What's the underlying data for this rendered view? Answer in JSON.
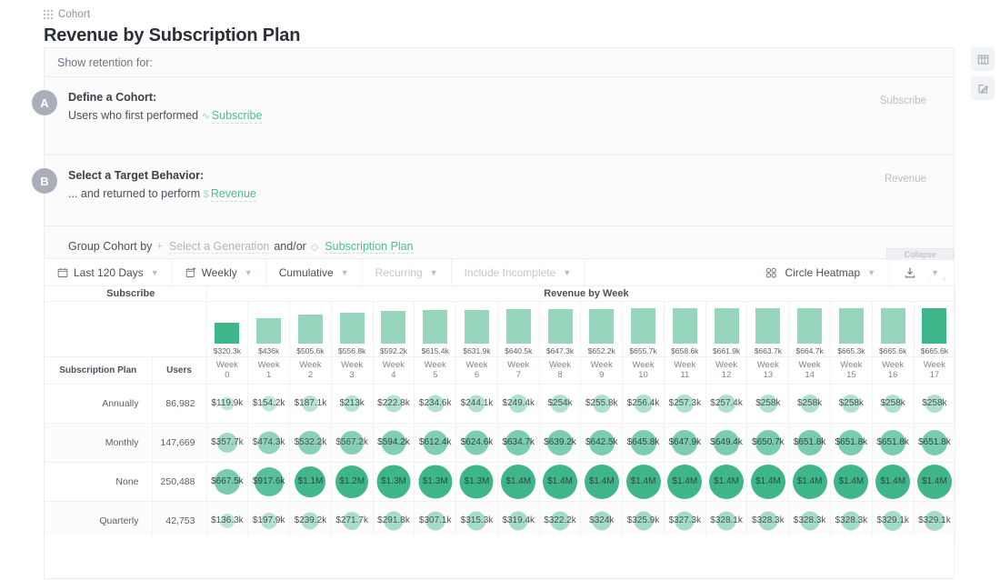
{
  "header": {
    "breadcrumb": "Cohort",
    "breadcrumb_icon": "grid-icon",
    "title": "Revenue by Subscription Plan"
  },
  "rail": {
    "items": [
      {
        "icon": "columns-icon",
        "name": "columns-panel-button"
      },
      {
        "icon": "edit-icon",
        "name": "edit-panel-button"
      }
    ]
  },
  "query": {
    "show_retention_label": "Show retention for:",
    "collapse_label": "Collapse",
    "steps": [
      {
        "badge": "A",
        "title": "Define a Cohort:",
        "prefix": "Users who first performed",
        "event_icon": "activity-icon",
        "event": "Subscribe",
        "right_label": "Subscribe"
      },
      {
        "badge": "B",
        "title": "Select a Target Behavior:",
        "prefix": "... and returned to perform",
        "event_icon": "dollar-icon",
        "event": "Revenue",
        "right_label": "Revenue"
      }
    ],
    "group_by": {
      "label": "Group Cohort by",
      "generation_icon": "plus-icon",
      "generation": "Select a Generation",
      "conjunction": "and/or",
      "property_icon": "tag-icon",
      "property": "Subscription Plan"
    }
  },
  "toolbar": {
    "date_range": "Last 120 Days",
    "date_range_icon": "calendar-icon",
    "interval": "Weekly",
    "interval_icon": "calendar-arrow-icon",
    "measure": "Cumulative",
    "recurring": "Recurring",
    "include_incomplete": "Include Incomplete",
    "viz": "Circle Heatmap",
    "viz_icon": "circle-heatmap-icon",
    "download_icon": "download-icon"
  },
  "table": {
    "corner_label": "Subscribe",
    "section_label": "Revenue by Week",
    "plan_header": "Subscription Plan",
    "users_header": "Users",
    "week_headers": [
      "Week\n0",
      "Week\n1",
      "Week\n2",
      "Week\n3",
      "Week\n4",
      "Week\n5",
      "Week\n6",
      "Week\n7",
      "Week\n8",
      "Week\n9",
      "Week\n10",
      "Week\n11",
      "Week\n12",
      "Week\n13",
      "Week\n14",
      "Week\n15",
      "Week\n16",
      "Week\n17"
    ]
  },
  "chart_data": {
    "type": "table",
    "title": "Revenue by Week",
    "xlabel": "Week",
    "ylabel": "Revenue",
    "categories": [
      "Week 0",
      "Week 1",
      "Week 2",
      "Week 3",
      "Week 4",
      "Week 5",
      "Week 6",
      "Week 7",
      "Week 8",
      "Week 9",
      "Week 10",
      "Week 11",
      "Week 12",
      "Week 13",
      "Week 14",
      "Week 15",
      "Week 16",
      "Week 17"
    ],
    "summary_bars": {
      "type": "bar",
      "labels": [
        "$320.3k",
        "$436k",
        "$505.6k",
        "$556.8k",
        "$592.2k",
        "$615.4k",
        "$631.9k",
        "$640.5k",
        "$647.3k",
        "$652.2k",
        "$655.7k",
        "$658.6k",
        "$661.9k",
        "$663.7k",
        "$664.7k",
        "$665.3k",
        "$665.6k",
        "$665.6k"
      ],
      "values": [
        320300,
        436000,
        505600,
        556800,
        592200,
        615400,
        631900,
        640500,
        647300,
        652200,
        655700,
        658600,
        661900,
        663700,
        664700,
        665300,
        665600,
        665600
      ],
      "highlighted_index": [
        0,
        17
      ],
      "bar_color": "#97d6bd",
      "highlight_color": "#3fb68a"
    },
    "rows": [
      {
        "plan": "Annually",
        "users": "86,982",
        "users_value": 86982,
        "values": [
          "$119.9k",
          "$154.2k",
          "$187.1k",
          "$213k",
          "$222.8k",
          "$234.6k",
          "$244.1k",
          "$249.4k",
          "$254k",
          "$255.8k",
          "$256.4k",
          "$257.3k",
          "$257.4k",
          "$258k",
          "$258k",
          "$258k",
          "$258k",
          "$258k"
        ],
        "numeric": [
          119900,
          154200,
          187100,
          213000,
          222800,
          234600,
          244100,
          249400,
          254000,
          255800,
          256400,
          257300,
          257400,
          258000,
          258000,
          258000,
          258000,
          258000
        ]
      },
      {
        "plan": "Monthly",
        "users": "147,669",
        "users_value": 147669,
        "values": [
          "$357.7k",
          "$474.3k",
          "$532.2k",
          "$567.2k",
          "$594.2k",
          "$612.4k",
          "$624.6k",
          "$634.7k",
          "$639.2k",
          "$642.5k",
          "$645.8k",
          "$647.9k",
          "$649.4k",
          "$650.7k",
          "$651.8k",
          "$651.8k",
          "$651.8k",
          "$651.8k"
        ],
        "numeric": [
          357700,
          474300,
          532200,
          567200,
          594200,
          612400,
          624600,
          634700,
          639200,
          642500,
          645800,
          647900,
          649400,
          650700,
          651800,
          651800,
          651800,
          651800
        ]
      },
      {
        "plan": "None",
        "users": "250,488",
        "users_value": 250488,
        "values": [
          "$667.5k",
          "$917.6k",
          "$1.1M",
          "$1.2M",
          "$1.3M",
          "$1.3M",
          "$1.3M",
          "$1.4M",
          "$1.4M",
          "$1.4M",
          "$1.4M",
          "$1.4M",
          "$1.4M",
          "$1.4M",
          "$1.4M",
          "$1.4M",
          "$1.4M",
          "$1.4M"
        ],
        "numeric": [
          667500,
          917600,
          1100000,
          1200000,
          1300000,
          1300000,
          1300000,
          1400000,
          1400000,
          1400000,
          1400000,
          1400000,
          1400000,
          1400000,
          1400000,
          1400000,
          1400000,
          1400000
        ]
      },
      {
        "plan": "Quarterly",
        "users": "42,753",
        "users_value": 42753,
        "values": [
          "$136.3k",
          "$197.9k",
          "$239.2k",
          "$271.7k",
          "$291.8k",
          "$307.1k",
          "$315.3k",
          "$319.4k",
          "$322.2k",
          "$324k",
          "$325.9k",
          "$327.3k",
          "$328.1k",
          "$328.3k",
          "$328.3k",
          "$328.3k",
          "$329.1k",
          "$329.1k"
        ],
        "numeric": [
          136300,
          197900,
          239200,
          271700,
          291800,
          307100,
          315300,
          319400,
          322200,
          324000,
          325900,
          327300,
          328100,
          328300,
          328300,
          328300,
          329100,
          329100
        ]
      }
    ],
    "colors": {
      "accent": "#3fb68a",
      "bar": "#97d6bd",
      "link": "#4fba93"
    }
  }
}
